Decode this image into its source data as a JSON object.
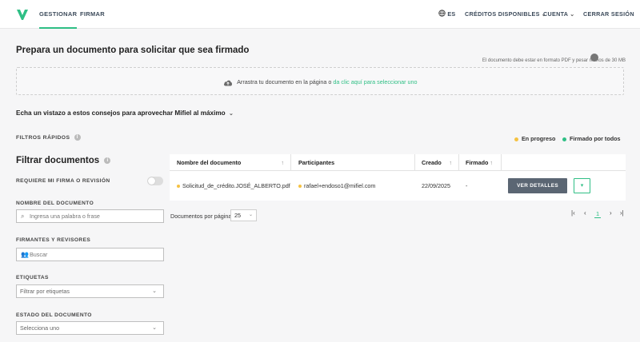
{
  "nav": {
    "tabs": [
      "GESTIONAR",
      "FIRMAR"
    ],
    "lang": "ES",
    "credits": "CRÉDITOS DISPONIBLES",
    "account": "CUENTA",
    "logout": "CERRAR SESIÓN"
  },
  "colors": {
    "accent": "#2fbf85",
    "pending": "#f5c242",
    "dark_button": "#5b6673"
  },
  "upload": {
    "title": "Prepara un documento para solicitar que sea firmado",
    "hint": "El documento debe estar en formato PDF y pesar menos de 30 MB",
    "drop_text": "Arrastra tu documento en la página o ",
    "drop_link": "da clic aquí para seleccionar uno"
  },
  "tips": "Echa un vistazo a estos consejos para aprovechar Mifiel al máximo",
  "quick_filters": {
    "label": "FILTROS RÁPIDOS",
    "in_progress": "En progreso",
    "signed_all": "Firmado por todos"
  },
  "filters": {
    "title": "Filtrar documentos",
    "require_label": "REQUIERE MI FIRMA O REVISIÓN",
    "doc_name_label": "NOMBRE DEL DOCUMENTO",
    "doc_name_placeholder": "Ingresa una palabra o frase",
    "signers_label": "FIRMANTES Y REVISORES",
    "signers_placeholder": "Buscar",
    "tags_label": "ETIQUETAS",
    "tags_placeholder": "Filtrar por etiquetas",
    "status_label": "ESTADO DEL DOCUMENTO",
    "status_placeholder": "Selecciona uno"
  },
  "table": {
    "headers": [
      "Nombre del documento",
      "Participantes",
      "Creado",
      "Firmado"
    ],
    "rows": [
      {
        "name": "Solicitud_de_crédito.JOSÉ_ALBERTO.pdf",
        "participant": "rafael+endoso1@mifiel.com",
        "created": "22/09/2025",
        "signed": "-",
        "action": "VER DETALLES"
      }
    ]
  },
  "pagination": {
    "per_page_label": "Documentos por página",
    "per_page": "25",
    "current_page": "1"
  }
}
